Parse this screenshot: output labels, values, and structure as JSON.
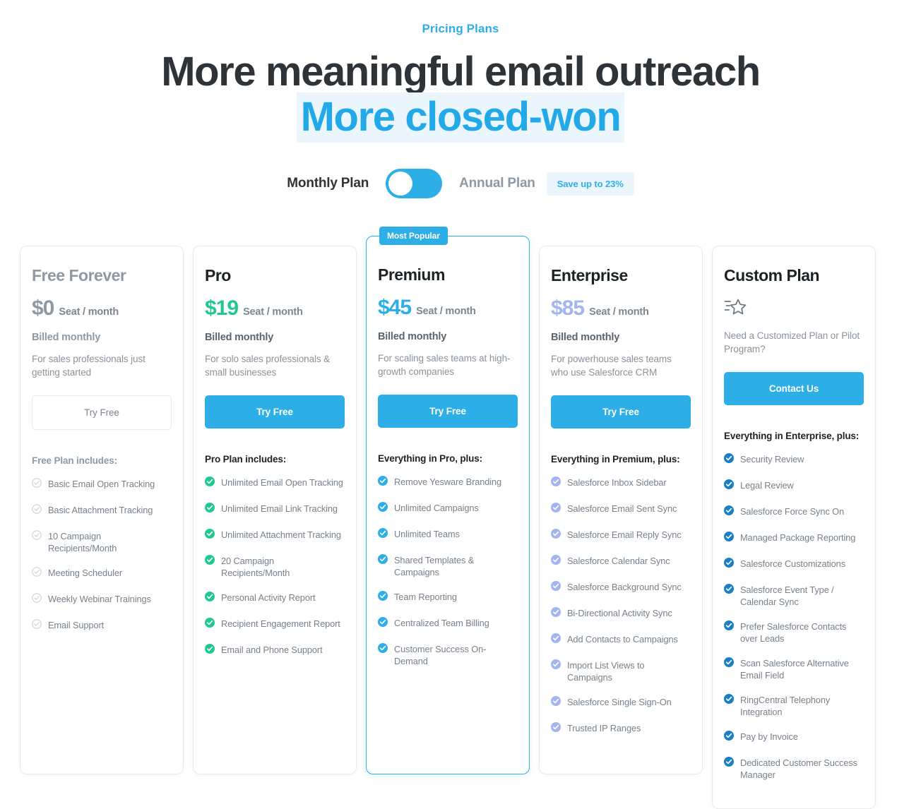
{
  "header": {
    "eyebrow": "Pricing Plans",
    "headline_line1": "More meaningful email outreach",
    "headline_line2": "More closed-won"
  },
  "billing_toggle": {
    "monthly_label": "Monthly Plan",
    "annual_label": "Annual Plan",
    "save_badge": "Save up to 23%",
    "selected": "Monthly Plan",
    "knob_position": "left"
  },
  "colors": {
    "accent_blue": "#2EAEE6",
    "headline_blue": "#23A9E8",
    "highlight_bg": "#EAF6FC",
    "green": "#22C98E",
    "periwinkle": "#A3B4F0",
    "deep_blue": "#1B7FC4",
    "gray_text": "#77818B",
    "muted_gray": "#8E99A4",
    "card_border": "#E6EAEE"
  },
  "plans": [
    {
      "name": "Free Forever",
      "name_style": "muted",
      "price": "$0",
      "price_color": "#8E99A4",
      "price_unit": "Seat / month",
      "billed": "Billed monthly",
      "billed_style": "muted",
      "description": "For sales professionals just getting started",
      "cta_label": "Try Free",
      "cta_style": "outline",
      "includes_title": "Free Plan includes:",
      "includes_title_style": "muted",
      "check_style": "outline-gray",
      "check_color": "#C9D0D7",
      "featured": false,
      "badge": null,
      "icon": null,
      "features": [
        "Basic Email Open Tracking",
        "Basic Attachment Tracking",
        "10 Campaign Recipients/Month",
        "Meeting Scheduler",
        "Weekly Webinar Trainings",
        "Email Support"
      ]
    },
    {
      "name": "Pro",
      "name_style": "dark",
      "price": "$19",
      "price_color": "#22C98E",
      "price_unit": "Seat / month",
      "billed": "Billed monthly",
      "billed_style": "dark",
      "description": "For solo sales professionals & small businesses",
      "cta_label": "Try Free",
      "cta_style": "filled",
      "includes_title": "Pro Plan includes:",
      "includes_title_style": "dark",
      "check_style": "filled",
      "check_color": "#22C98E",
      "featured": false,
      "badge": null,
      "icon": null,
      "features": [
        "Unlimited Email Open Tracking",
        "Unlimited Email Link Tracking",
        "Unlimited Attachment Tracking",
        "20 Campaign Recipients/Month",
        "Personal Activity Report",
        "Recipient Engagement Report",
        "Email and Phone Support"
      ]
    },
    {
      "name": "Premium",
      "name_style": "dark",
      "price": "$45",
      "price_color": "#2EAEE6",
      "price_unit": "Seat / month",
      "billed": "Billed monthly",
      "billed_style": "dark",
      "description": "For scaling sales teams at high-growth companies",
      "cta_label": "Try Free",
      "cta_style": "filled",
      "includes_title": "Everything in Pro, plus:",
      "includes_title_style": "dark",
      "check_style": "filled",
      "check_color": "#2EAEE6",
      "featured": true,
      "badge": "Most Popular",
      "icon": null,
      "features": [
        "Remove Yesware Branding",
        "Unlimited Campaigns",
        "Unlimited Teams",
        "Shared Templates & Campaigns",
        "Team Reporting",
        "Centralized Team Billing",
        "Customer Success On-Demand"
      ]
    },
    {
      "name": "Enterprise",
      "name_style": "dark",
      "price": "$85",
      "price_color": "#A3B4F0",
      "price_unit": "Seat / month",
      "billed": "Billed monthly",
      "billed_style": "dark",
      "description": "For powerhouse sales teams who use Salesforce CRM",
      "cta_label": "Try Free",
      "cta_style": "filled",
      "includes_title": "Everything in Premium, plus:",
      "includes_title_style": "dark",
      "check_style": "filled",
      "check_color": "#A3B4F0",
      "featured": false,
      "badge": null,
      "icon": null,
      "features": [
        "Salesforce Inbox Sidebar",
        "Salesforce Email Sent Sync",
        "Salesforce Email Reply Sync",
        "Salesforce Calendar Sync",
        "Salesforce Background Sync",
        "Bi-Directional Activity Sync",
        "Add Contacts to Campaigns",
        "Import List Views to Campaigns",
        "Salesforce Single Sign-On",
        "Trusted IP Ranges"
      ]
    },
    {
      "name": "Custom Plan",
      "name_style": "dark",
      "price": null,
      "price_color": null,
      "price_unit": null,
      "billed": null,
      "billed_style": "dark",
      "description": "Need a Customized Plan or Pilot Program?",
      "cta_label": "Contact Us",
      "cta_style": "filled",
      "includes_title": "Everything in Enterprise, plus:",
      "includes_title_style": "dark",
      "check_style": "filled",
      "check_color": "#1B7FC4",
      "featured": false,
      "badge": null,
      "icon": "shooting-star-icon",
      "features": [
        "Security Review",
        "Legal Review",
        "Salesforce Force Sync On",
        "Managed Package Reporting",
        "Salesforce Customizations",
        "Salesforce Event Type / Calendar Sync",
        "Prefer Salesforce Contacts over Leads",
        "Scan Salesforce Alternative Email Field",
        "RingCentral Telephony Integration",
        "Pay by Invoice",
        "Dedicated Customer Success Manager"
      ]
    }
  ]
}
